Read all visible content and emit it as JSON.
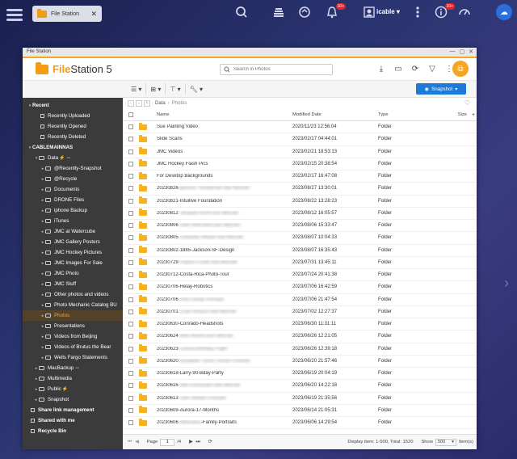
{
  "topbar": {
    "tab_label": "File Station",
    "tab_close": "✕",
    "user_name": "icable",
    "badges": {
      "notifications": "10+",
      "events": "10+"
    }
  },
  "window": {
    "title": "File Station",
    "logo_pre": "File",
    "logo_mid": "Station",
    "logo_num": " 5",
    "search_placeholder": "Search in Photos"
  },
  "toolbar": {
    "snapshot_label": "Snapshot"
  },
  "breadcrumb": {
    "root": "Data",
    "current": "Photos"
  },
  "sidebar": {
    "recent_header": "Recent",
    "recent": [
      "Recently Uploaded",
      "Recently Opened",
      "Recently Deleted"
    ],
    "nas_header": "CABLEMAINNAS",
    "data_label": "Data",
    "data_children": [
      "@Recently-Snapshot",
      "@Recycle",
      "Documents",
      "DRONE Files",
      "iphone Backup",
      "iTunes",
      "JMC at Watercube",
      "JMC Gallery Posters",
      "JMC Hockey Pictures",
      "JMC Images For Sale",
      "JMC Photo",
      "JMC Stuff",
      "Other photos and videos",
      "Photo Mechanic Catalog BU",
      "Photos",
      "Presentations",
      "Videos from Beijing",
      "Videos of Brutus the Bear",
      "Wells Fargo Statements"
    ],
    "top_folders": [
      "MacBackup",
      "Multimedia",
      "Public",
      "Snapshot"
    ],
    "bottom": [
      "Share link management",
      "Shared with me",
      "Recycle Bin"
    ]
  },
  "table": {
    "headers": {
      "name": "Name",
      "modified": "Modified Date",
      "type": "Type",
      "size": "Size"
    },
    "rows": [
      {
        "name": "Sue Painting Video",
        "modified": "2020/11/23 12:56:04",
        "type": "Folder"
      },
      {
        "name": "Slide Scans",
        "modified": "2023/02/17 04:44:01",
        "type": "Folder"
      },
      {
        "name": "JMC Videos",
        "modified": "2023/02/21 18:53:13",
        "type": "Folder"
      },
      {
        "name": "JMC Hockey Flash Pics",
        "modified": "2023/02/15 20:38:54",
        "type": "Folder"
      },
      {
        "name": "For Desktop Backgrounds",
        "modified": "2023/02/17 16:47:08",
        "type": "Folder"
      },
      {
        "name": "20230826",
        "blur": "Spencer-Yandelman-Bar-Mitzvah",
        "modified": "2023/08/27 13:30:01",
        "type": "Folder"
      },
      {
        "name": "20230821-Intuitive Foundation",
        "modified": "2023/08/22 13:28:23",
        "type": "Folder"
      },
      {
        "name": "20230812",
        "blur": "-Jacques-Kohn-Bar-Mitzvah",
        "modified": "2023/08/12 16:05:57",
        "type": "Folder"
      },
      {
        "name": "20230806",
        "blur": "-Seth-Weinstein-Bar-Mitzvah",
        "modified": "2023/08/06 15:33:47",
        "type": "Folder"
      },
      {
        "name": "20230805",
        "blur": "-Charlotte-Weiser-Bat-Mitzvah",
        "modified": "2023/08/07 10:04:33",
        "type": "Folder"
      },
      {
        "name": "20230802-1885-Jackson-SF-Design",
        "modified": "2023/08/07 16:35:43",
        "type": "Folder"
      },
      {
        "name": "20230729",
        "blur": "-Peyton-Fisher-Bat-Mitzvah",
        "modified": "2023/07/31 13:45:11",
        "type": "Folder"
      },
      {
        "name": "20230712-Costa-Rica-Photo-Tour",
        "modified": "2023/07/24 20:41:38",
        "type": "Folder"
      },
      {
        "name": "20230706-Relay-Robotics",
        "modified": "2023/07/06 16:42:59",
        "type": "Folder"
      },
      {
        "name": "20230706",
        "blur": "-Holt-Family-Portraits",
        "modified": "2023/07/06 21:47:54",
        "type": "Folder"
      },
      {
        "name": "20230701",
        "blur": "-Evan-Strauss-Bar-Mitzvah",
        "modified": "2023/07/02 12:27:37",
        "type": "Folder"
      },
      {
        "name": "20230630-Conrado-Headshots",
        "modified": "2023/06/30 11:31:11",
        "type": "Folder"
      },
      {
        "name": "20230624",
        "blur": "-Max-Marino-Bar-Mitzvah",
        "modified": "2023/06/26 12:21:05",
        "type": "Folder"
      },
      {
        "name": "20230623",
        "blur": "-Louisa-Birthday-Flight",
        "modified": "2023/06/26 12:39:18",
        "type": "Folder"
      },
      {
        "name": "20230620",
        "blur": "-Elizabeth-Torres-Senior-Portraits",
        "modified": "2023/06/20 21:57:46",
        "type": "Folder"
      },
      {
        "name": "20230618-Larry-90-Bday-Party",
        "modified": "2023/06/19 20:04:19",
        "type": "Folder"
      },
      {
        "name": "20230616",
        "blur": "-Mia-Guimaraes-Bat-Mitzvah",
        "modified": "2023/06/20 14:22:18",
        "type": "Folder"
      },
      {
        "name": "20230613",
        "blur": "-Sam-Wexler-Portraits",
        "modified": "2023/06/19 21:35:56",
        "type": "Folder"
      },
      {
        "name": "20230609-Aurora-17-Months",
        "modified": "2023/06/14 21:05:31",
        "type": "Folder"
      },
      {
        "name": "20230606",
        "blur": "-Weinstein",
        "suffix": "-Family-Portraits",
        "modified": "2023/06/06 14:29:54",
        "type": "Folder"
      }
    ]
  },
  "footer": {
    "page_label": "Page",
    "page_value": "1",
    "page_total": "/4",
    "display_info": "Display item: 1-500, Total: 1520",
    "show_label": "Show",
    "show_value": "500",
    "items_label": "Item(s)"
  }
}
